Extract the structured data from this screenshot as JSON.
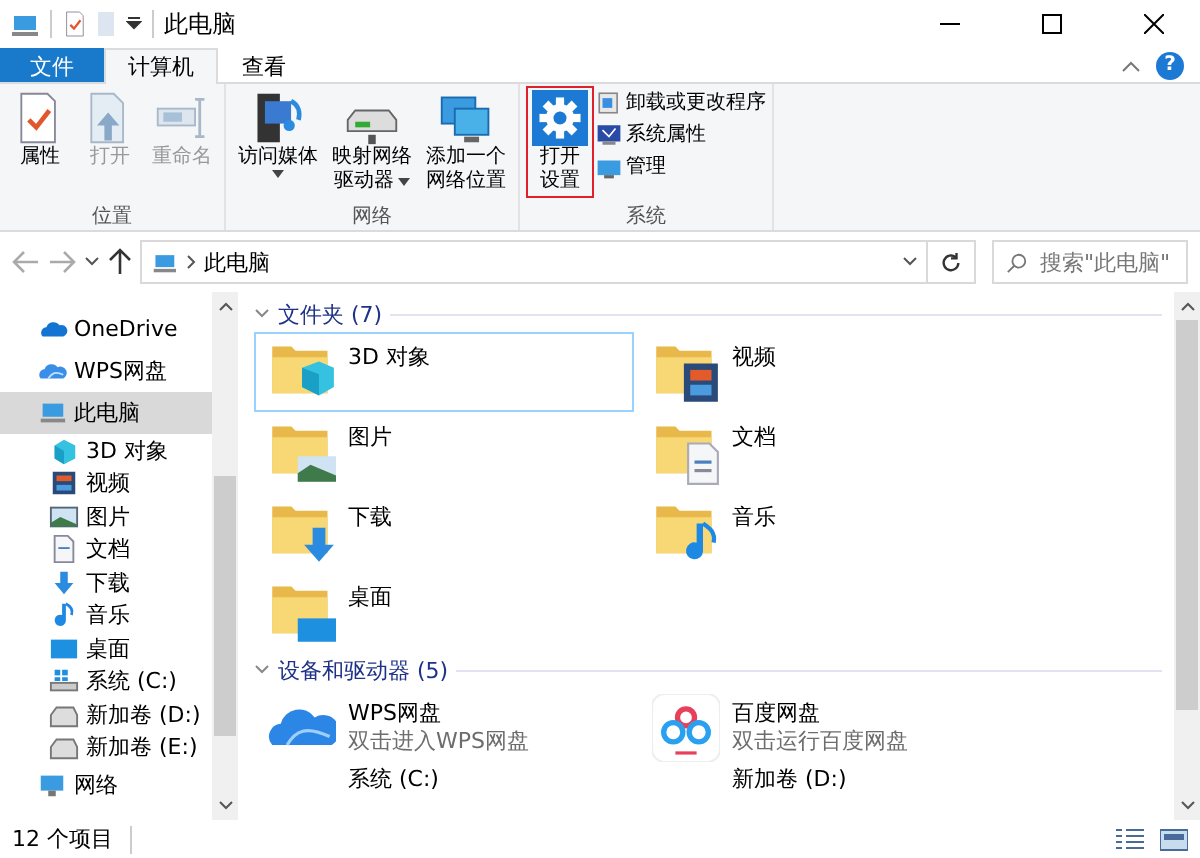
{
  "window": {
    "title": "此电脑"
  },
  "tabs": [
    {
      "label": "文件",
      "kind": "file",
      "selected": false
    },
    {
      "label": "计算机",
      "kind": "tab",
      "selected": true
    },
    {
      "label": "查看",
      "kind": "tab",
      "selected": false
    }
  ],
  "help": "?",
  "ribbon": [
    {
      "label": "位置",
      "items": [
        {
          "kind": "large",
          "lines": [
            "属性"
          ],
          "disabled": false,
          "dropdown": false,
          "highlighted": false
        },
        {
          "kind": "large",
          "lines": [
            "打开"
          ],
          "disabled": true,
          "dropdown": false,
          "highlighted": false
        },
        {
          "kind": "large",
          "lines": [
            "重命名"
          ],
          "disabled": true,
          "dropdown": false,
          "highlighted": false
        }
      ]
    },
    {
      "label": "网络",
      "items": [
        {
          "kind": "large",
          "lines": [
            "访问媒体"
          ],
          "disabled": false,
          "dropdown": true,
          "highlighted": false
        },
        {
          "kind": "large",
          "lines": [
            "映射网络",
            "驱动器"
          ],
          "disabled": false,
          "dropdown": true,
          "highlighted": false
        },
        {
          "kind": "large",
          "lines": [
            "添加一个",
            "网络位置"
          ],
          "disabled": false,
          "dropdown": false,
          "highlighted": false
        }
      ]
    },
    {
      "label": "系统",
      "items": [
        {
          "kind": "large",
          "lines": [
            "打开",
            "设置"
          ],
          "disabled": false,
          "dropdown": false,
          "highlighted": true
        },
        {
          "kind": "small",
          "lines": [
            "卸载或更改程序"
          ]
        },
        {
          "kind": "small",
          "lines": [
            "系统属性"
          ]
        },
        {
          "kind": "small",
          "lines": [
            "管理"
          ]
        }
      ]
    }
  ],
  "address": {
    "path": "此电脑",
    "search_placeholder": "搜索\"此电脑\""
  },
  "nav": [
    {
      "label": "OneDrive",
      "kind": "onedrive",
      "selected": false
    },
    {
      "label": "WPS网盘",
      "kind": "wps",
      "selected": false
    },
    {
      "label": "此电脑",
      "kind": "pc",
      "selected": true
    },
    {
      "label": "3D 对象",
      "kind": "cube",
      "selected": false
    },
    {
      "label": "视频",
      "kind": "video",
      "selected": false
    },
    {
      "label": "图片",
      "kind": "picture",
      "selected": false
    },
    {
      "label": "文档",
      "kind": "document",
      "selected": false
    },
    {
      "label": "下载",
      "kind": "download",
      "selected": false
    },
    {
      "label": "音乐",
      "kind": "music",
      "selected": false
    },
    {
      "label": "桌面",
      "kind": "desktop",
      "selected": false
    },
    {
      "label": "系统 (C:)",
      "kind": "sysdrive",
      "selected": false
    },
    {
      "label": "新加卷 (D:)",
      "kind": "drive",
      "selected": false
    },
    {
      "label": "新加卷 (E:)",
      "kind": "drive",
      "selected": false
    },
    {
      "label": "网络",
      "kind": "network",
      "selected": false
    }
  ],
  "sections": [
    {
      "title": "文件夹 (7)",
      "items": [
        {
          "name": "3D 对象",
          "kind": "cube",
          "selected": true
        },
        {
          "name": "视频",
          "kind": "video",
          "selected": false
        },
        {
          "name": "图片",
          "kind": "picture",
          "selected": false
        },
        {
          "name": "文档",
          "kind": "document",
          "selected": false
        },
        {
          "name": "下载",
          "kind": "download",
          "selected": false
        },
        {
          "name": "音乐",
          "kind": "music",
          "selected": false
        },
        {
          "name": "桌面",
          "kind": "desktop",
          "selected": false
        }
      ]
    },
    {
      "title": "设备和驱动器 (5)",
      "items": [
        {
          "name": "WPS网盘",
          "subtitle": "双击进入WPS网盘",
          "kind": "wps",
          "selected": false
        },
        {
          "name": "百度网盘",
          "subtitle": "双击运行百度网盘",
          "kind": "baidu",
          "selected": false
        },
        {
          "name": "系统 (C:)",
          "kind": "sysdrive",
          "selected": false
        },
        {
          "name": "新加卷 (D:)",
          "kind": "drive",
          "selected": false
        }
      ]
    }
  ],
  "status_bar": {
    "count": "12 个项目"
  }
}
